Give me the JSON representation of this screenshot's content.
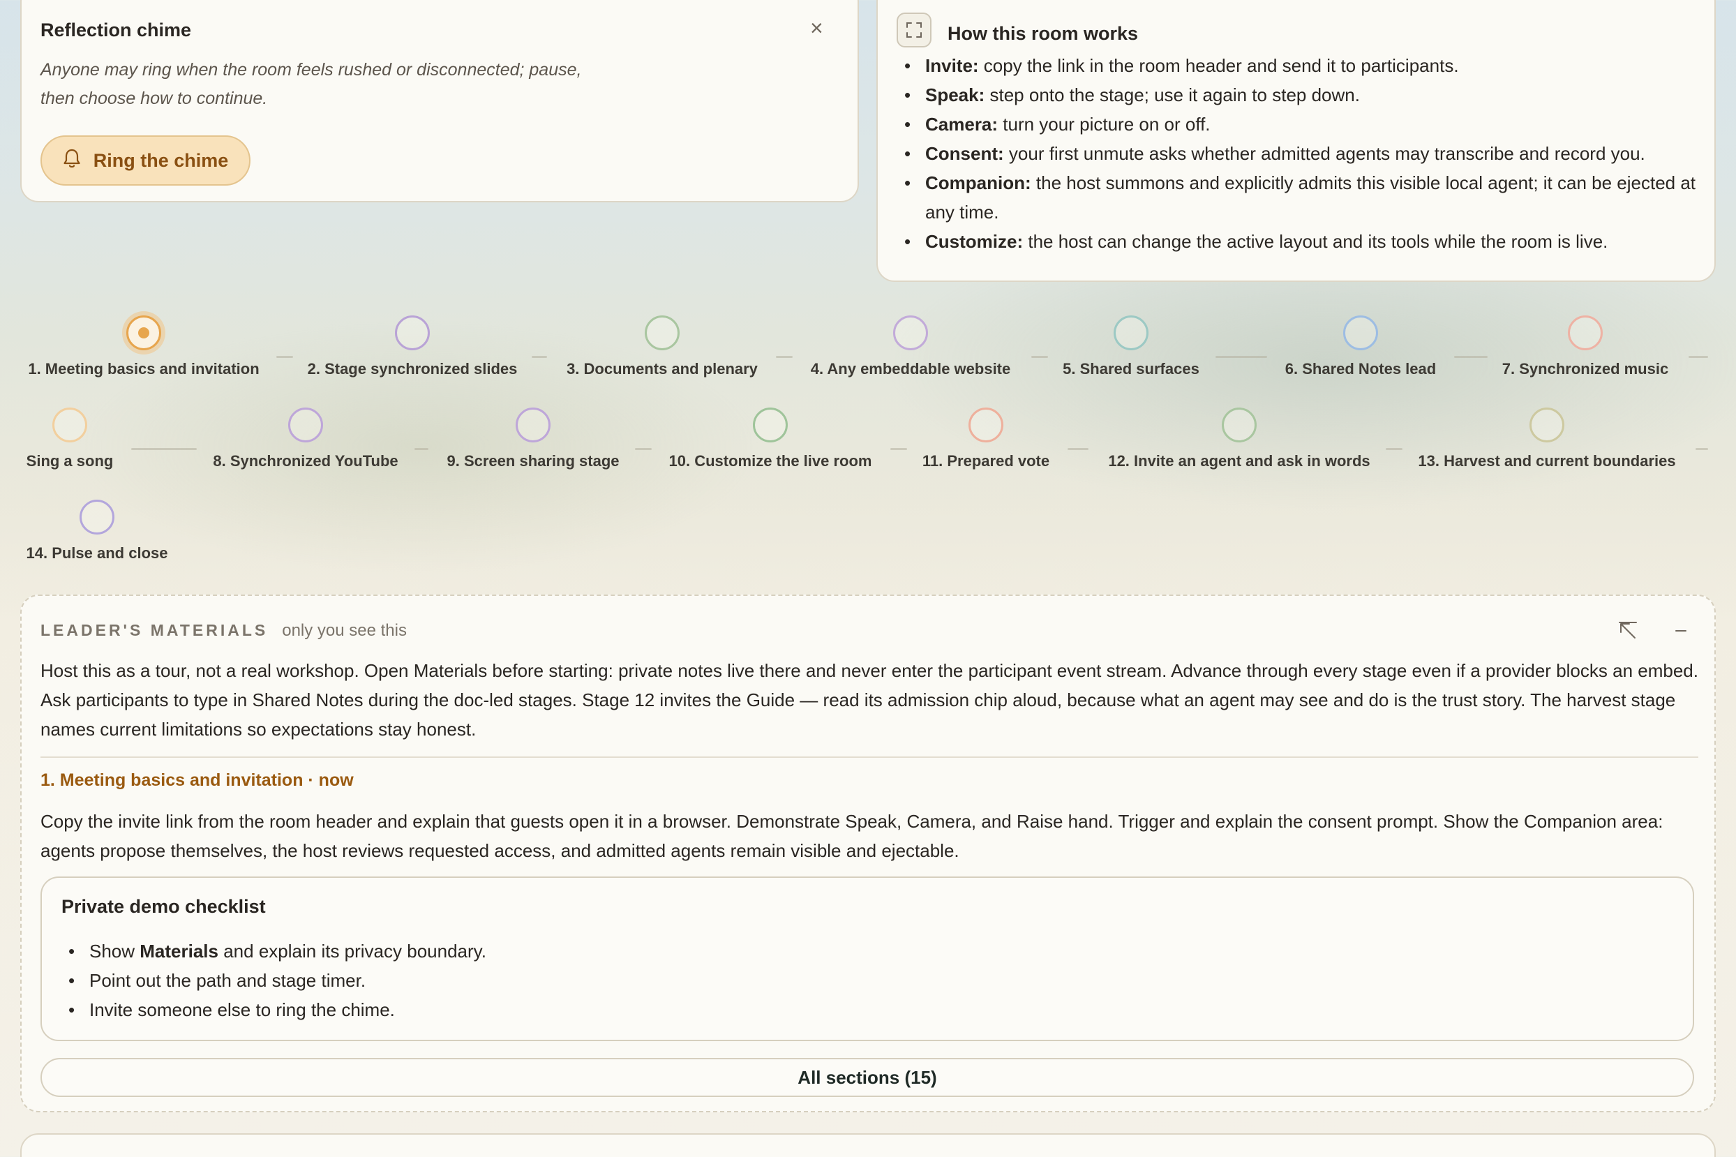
{
  "chime": {
    "title": "Reflection chime",
    "close_label": "×",
    "description": "Anyone may ring when the room feels rushed or disconnected; pause, then choose how to continue.",
    "ring_label": "Ring the chime"
  },
  "how": {
    "title": "How this room works",
    "items": [
      {
        "term": "Invite:",
        "text": " copy the link in the room header and send it to participants."
      },
      {
        "term": "Speak:",
        "text": " step onto the stage; use it again to step down."
      },
      {
        "term": "Camera:",
        "text": " turn your picture on or off."
      },
      {
        "term": "Consent:",
        "text": " your first unmute asks whether admitted agents may transcribe and record you."
      },
      {
        "term": "Companion:",
        "text": " the host summons and explicitly admits this visible local agent; it can be ejected at any time."
      },
      {
        "term": "Customize:",
        "text": " the host can change the active layout and its tools while the room is live."
      }
    ]
  },
  "stages": [
    {
      "label": "1. Meeting basics and invitation",
      "color": "#e7a54d",
      "active": true
    },
    {
      "label": "2. Stage synchronized slides",
      "color": "#b9a3d6"
    },
    {
      "label": "3. Documents and plenary",
      "color": "#a9c6a0"
    },
    {
      "label": "4. Any embeddable website",
      "color": "#c2abd9"
    },
    {
      "label": "5. Shared surfaces",
      "color": "#9cc9c4"
    },
    {
      "label": "6. Shared Notes lead",
      "color": "#9dbde3"
    },
    {
      "label": "7. Synchronized music",
      "color": "#eeb2a4"
    },
    {
      "label": "Sing a song",
      "color": "#f2cf9e"
    },
    {
      "label": "8. Synchronized YouTube",
      "color": "#bea6d9"
    },
    {
      "label": "9. Screen sharing stage",
      "color": "#bea6d9"
    },
    {
      "label": "10. Customize the live room",
      "color": "#9fc49a"
    },
    {
      "label": "11. Prepared vote",
      "color": "#eeb09c"
    },
    {
      "label": "12. Invite an agent and ask in words",
      "color": "#a9c6a0"
    },
    {
      "label": "13. Harvest and current boundaries",
      "color": "#cdc9a0"
    },
    {
      "label": "14. Pulse and close",
      "color": "#b3a6dc"
    }
  ],
  "materials": {
    "heading": "LEADER'S MATERIALS",
    "subheading": "only you see this",
    "intro": "Host this as a tour, not a real workshop. Open Materials before starting: private notes live there and never enter the participant event stream. Advance through every stage even if a provider blocks an embed. Ask participants to type in Shared Notes during the doc-led stages. Stage 12 invites the Guide — read its admission chip aloud, because what an agent may see and do is the trust story. The harvest stage names current limitations so expectations stay honest.",
    "stage_heading": "1. Meeting basics and invitation · now",
    "stage_text": "Copy the invite link from the room header and explain that guests open it in a browser. Demonstrate Speak, Camera, and Raise hand. Trigger and explain the consent prompt. Show the Companion area: agents propose themselves, the host reviews requested access, and admitted agents remain visible and ejectable.",
    "checklist": {
      "title": "Private demo checklist",
      "item1_pre": "Show ",
      "item1_bold": "Materials",
      "item1_post": " and explain its privacy boundary.",
      "item2": "Point out the path and stage timer.",
      "item3": "Invite someone else to ring the chime."
    },
    "all_sections": "All sections (15)"
  }
}
